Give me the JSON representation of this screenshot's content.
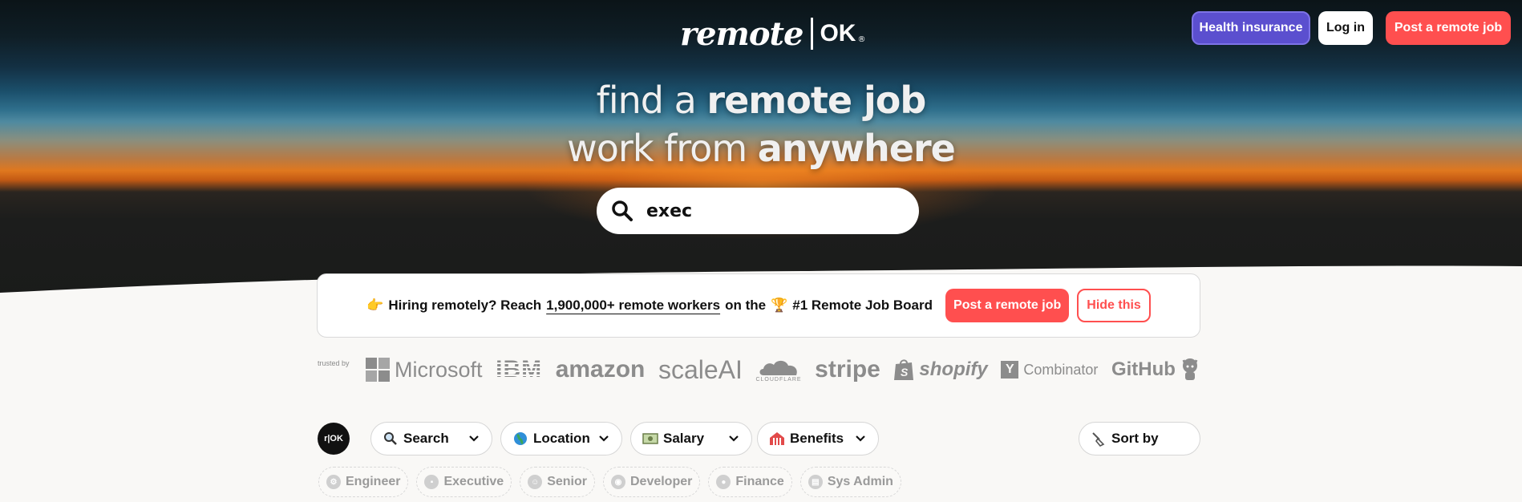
{
  "header": {
    "logo_main": "remote",
    "logo_suffix": "OK",
    "logo_mark": "®",
    "buttons": {
      "health_insurance": "Health insurance",
      "login": "Log in",
      "post_job": "Post a remote job"
    }
  },
  "hero": {
    "line1_plain": "find a ",
    "line1_bold": "remote job",
    "line2_plain": "work from ",
    "line2_bold": "anywhere",
    "search": {
      "value": "exec",
      "icon": "search-icon"
    }
  },
  "promo": {
    "emoji": "👉",
    "text_prefix": "Hiring remotely? Reach",
    "link_text": "1,900,000+ remote workers",
    "text_middle": "on the",
    "trophy": "🏆",
    "text_suffix": "#1 Remote Job Board",
    "post_button": "Post a remote job",
    "hide_button": "Hide this"
  },
  "trusted": {
    "label": "trusted by",
    "brands": [
      "Microsoft",
      "IBM",
      "amazon",
      "scaleAI",
      "CLOUDFLARE",
      "stripe",
      "shopify",
      "Combinator",
      "GitHub"
    ]
  },
  "filters": {
    "badge": "r|OK",
    "search": "Search",
    "location": "Location",
    "salary": "Salary",
    "benefits": "Benefits",
    "sort": "Sort by"
  },
  "tags": [
    "Engineer",
    "Executive",
    "Senior",
    "Developer",
    "Finance",
    "Sys Admin"
  ],
  "colors": {
    "accent_red": "#ff4f4f",
    "health_purple": "#5b4fcf"
  }
}
